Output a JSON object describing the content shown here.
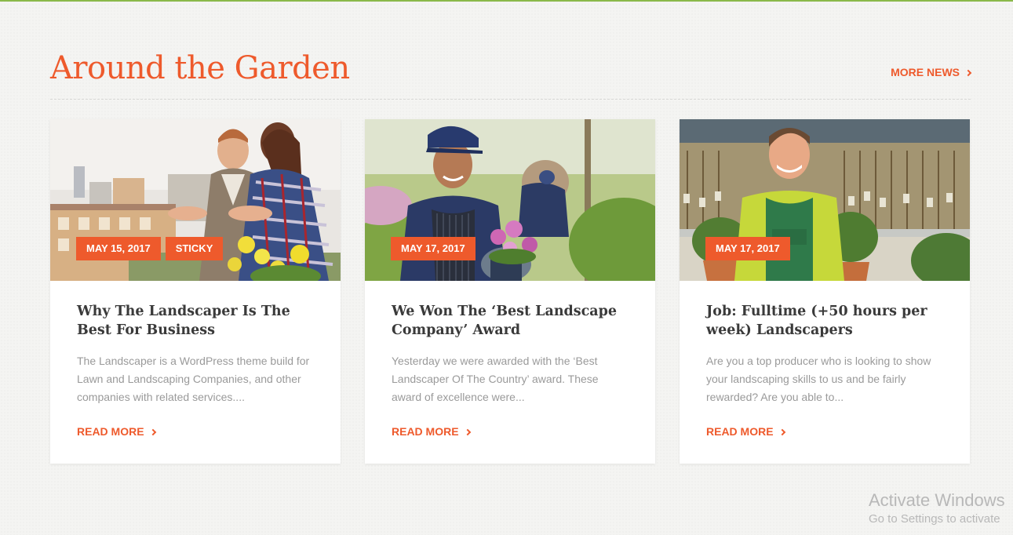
{
  "section": {
    "title": "Around the Garden",
    "more_label": "MORE NEWS",
    "accent_color": "#ee5a2c"
  },
  "cards": [
    {
      "badges": [
        "MAY 15, 2017",
        "STICKY"
      ],
      "title": "Why The Landscaper Is The Best For Business",
      "excerpt": "The Landscaper is a WordPress theme build for Lawn and Landscaping Companies, and other companies with related services....",
      "read_more": "READ MORE",
      "image": "couple-hugging-garden-photo"
    },
    {
      "badges": [
        "MAY 17, 2017"
      ],
      "title": "We Won The ‘Best Landscape Company’ Award",
      "excerpt": "Yesterday we were awarded with the ‘Best Landscaper Of The Country’ award. These award of excellence were...",
      "read_more": "READ MORE",
      "image": "gardener-woman-with-flowers-photo"
    },
    {
      "badges": [
        "MAY 17, 2017"
      ],
      "title": "Job: Fulltime (+50 hours per week) Landscapers",
      "excerpt": "Are you a top producer who is looking to show your landscaping skills to us and be fairly rewarded? Are you able to...",
      "read_more": "READ MORE",
      "image": "gardener-man-with-shrubs-photo"
    }
  ],
  "watermark": {
    "title": "Activate Windows",
    "subtitle": "Go to Settings to activate"
  }
}
